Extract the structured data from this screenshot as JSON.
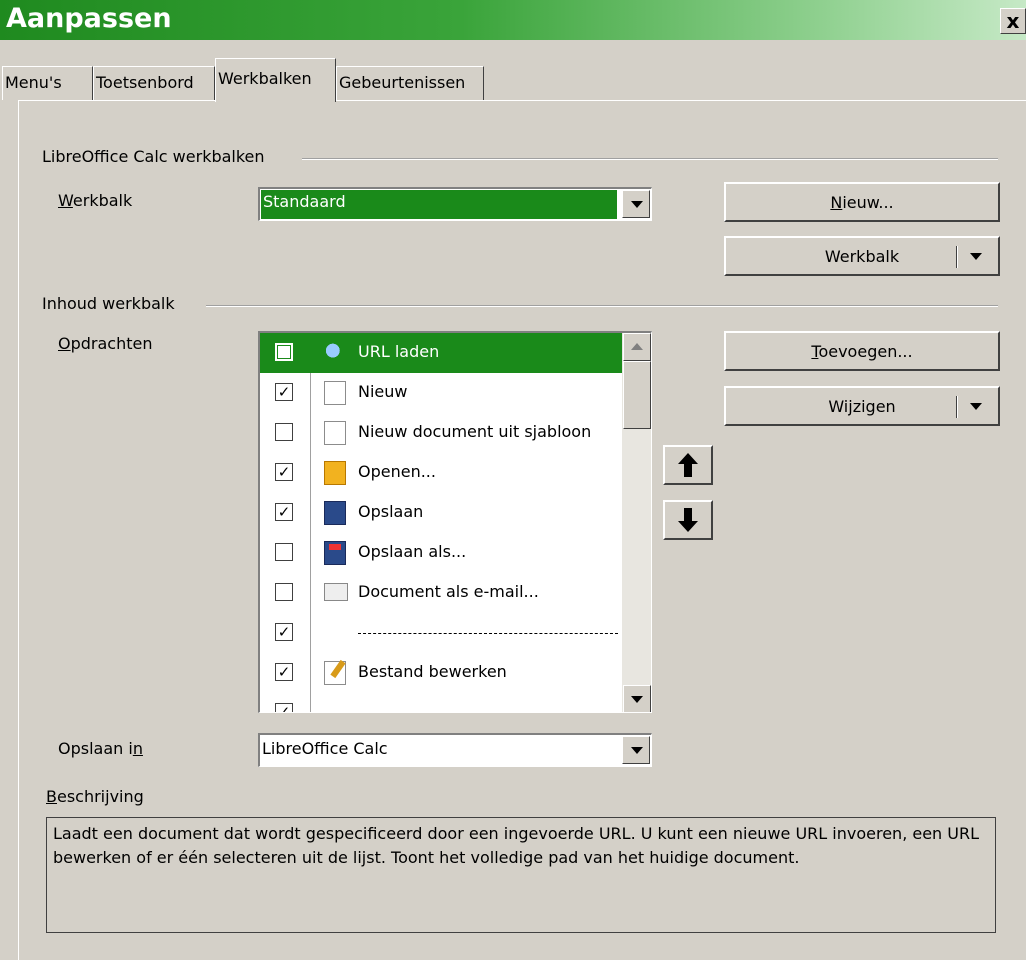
{
  "window": {
    "title": "Aanpassen",
    "close_label": "x"
  },
  "tabs": [
    {
      "label": "Menu's",
      "active": false
    },
    {
      "label": "Toetsenbord",
      "active": false
    },
    {
      "label": "Werkbalken",
      "active": true
    },
    {
      "label": "Gebeurtenissen",
      "active": false
    }
  ],
  "toolbars_group": {
    "title": "LibreOffice Calc werkbalken",
    "toolbar_label": "Werkbalk",
    "toolbar_value": "Standaard",
    "new_button": "Nieuw...",
    "toolbar_menu_button": "Werkbalk"
  },
  "content_group": {
    "title": "Inhoud werkbalk",
    "commands_label": "Opdrachten",
    "add_button": "Toevoegen...",
    "modify_button": "Wijzigen",
    "commands": [
      {
        "label": "URL laden",
        "checked": false,
        "icon": "url-icon",
        "selected": true
      },
      {
        "label": "Nieuw",
        "checked": true,
        "icon": "new-document-icon"
      },
      {
        "label": "Nieuw document uit sjabloon",
        "checked": false,
        "icon": "template-document-icon"
      },
      {
        "label": "Openen...",
        "checked": true,
        "icon": "open-folder-icon"
      },
      {
        "label": "Opslaan",
        "checked": true,
        "icon": "save-icon"
      },
      {
        "label": "Opslaan als...",
        "checked": false,
        "icon": "save-as-icon"
      },
      {
        "label": "Document als e-mail...",
        "checked": false,
        "icon": "email-document-icon"
      },
      {
        "label": "",
        "checked": true,
        "icon": "",
        "separator": true
      },
      {
        "label": "Bestand bewerken",
        "checked": true,
        "icon": "edit-file-icon"
      }
    ]
  },
  "save_in": {
    "label": "Opslaan in",
    "value": "LibreOffice Calc"
  },
  "description": {
    "label": "Beschrijving",
    "text": "Laadt een document dat wordt gespecificeerd door een ingevoerde URL. U kunt een nieuwe URL invoeren, een URL bewerken of er één selecteren uit de lijst. Toont het volledige pad van het huidige document."
  },
  "colors": {
    "title_green": "#1f8a1f",
    "selection_green": "#1a8a1a",
    "dialog_bg": "#d4d0c8"
  }
}
